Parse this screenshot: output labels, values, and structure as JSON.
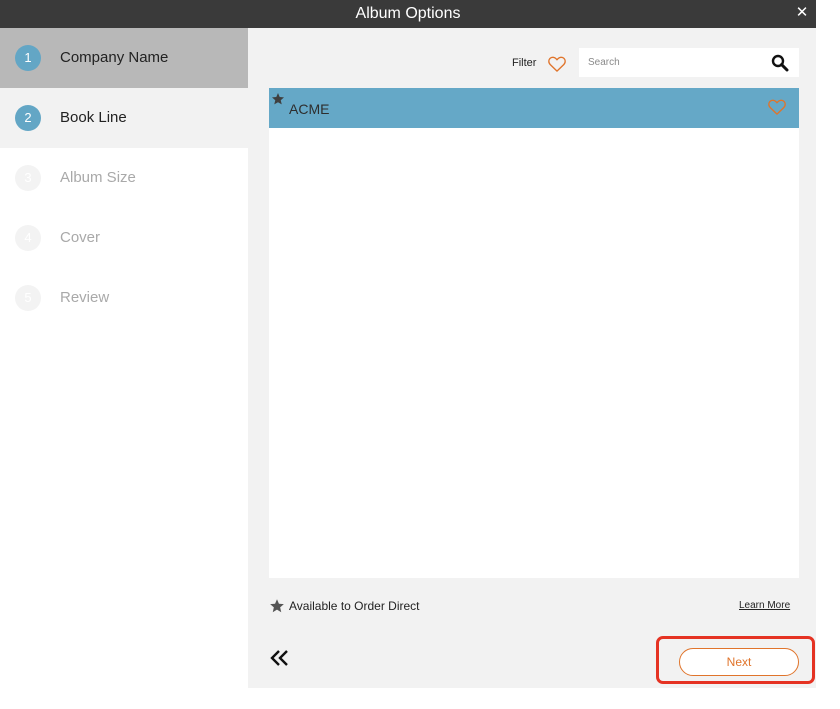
{
  "window": {
    "title": "Album Options",
    "close_symbol": "✕"
  },
  "steps": [
    {
      "number": "1",
      "label": "Company Name",
      "state": "done"
    },
    {
      "number": "2",
      "label": "Book Line",
      "state": "current"
    },
    {
      "number": "3",
      "label": "Album Size",
      "state": "pending"
    },
    {
      "number": "4",
      "label": "Cover",
      "state": "pending"
    },
    {
      "number": "5",
      "label": "Review",
      "state": "pending"
    }
  ],
  "toolbar": {
    "filter_label": "Filter",
    "filter_icon": "heart-outline-icon",
    "search_placeholder": "Search",
    "search_value": "",
    "search_icon": "magnifier-icon"
  },
  "list": {
    "items": [
      {
        "label": "ACME",
        "starred": true,
        "favorite": false
      }
    ]
  },
  "footer": {
    "legend_text": "Available to Order Direct",
    "learn_more": "Learn More",
    "back_icon": "double-chevron-left-icon",
    "next_label": "Next"
  },
  "colors": {
    "accent_blue": "#63a6c5",
    "accent_orange": "#e0742b",
    "highlight_red": "#e53323",
    "titlebar": "#3a3a3a"
  }
}
